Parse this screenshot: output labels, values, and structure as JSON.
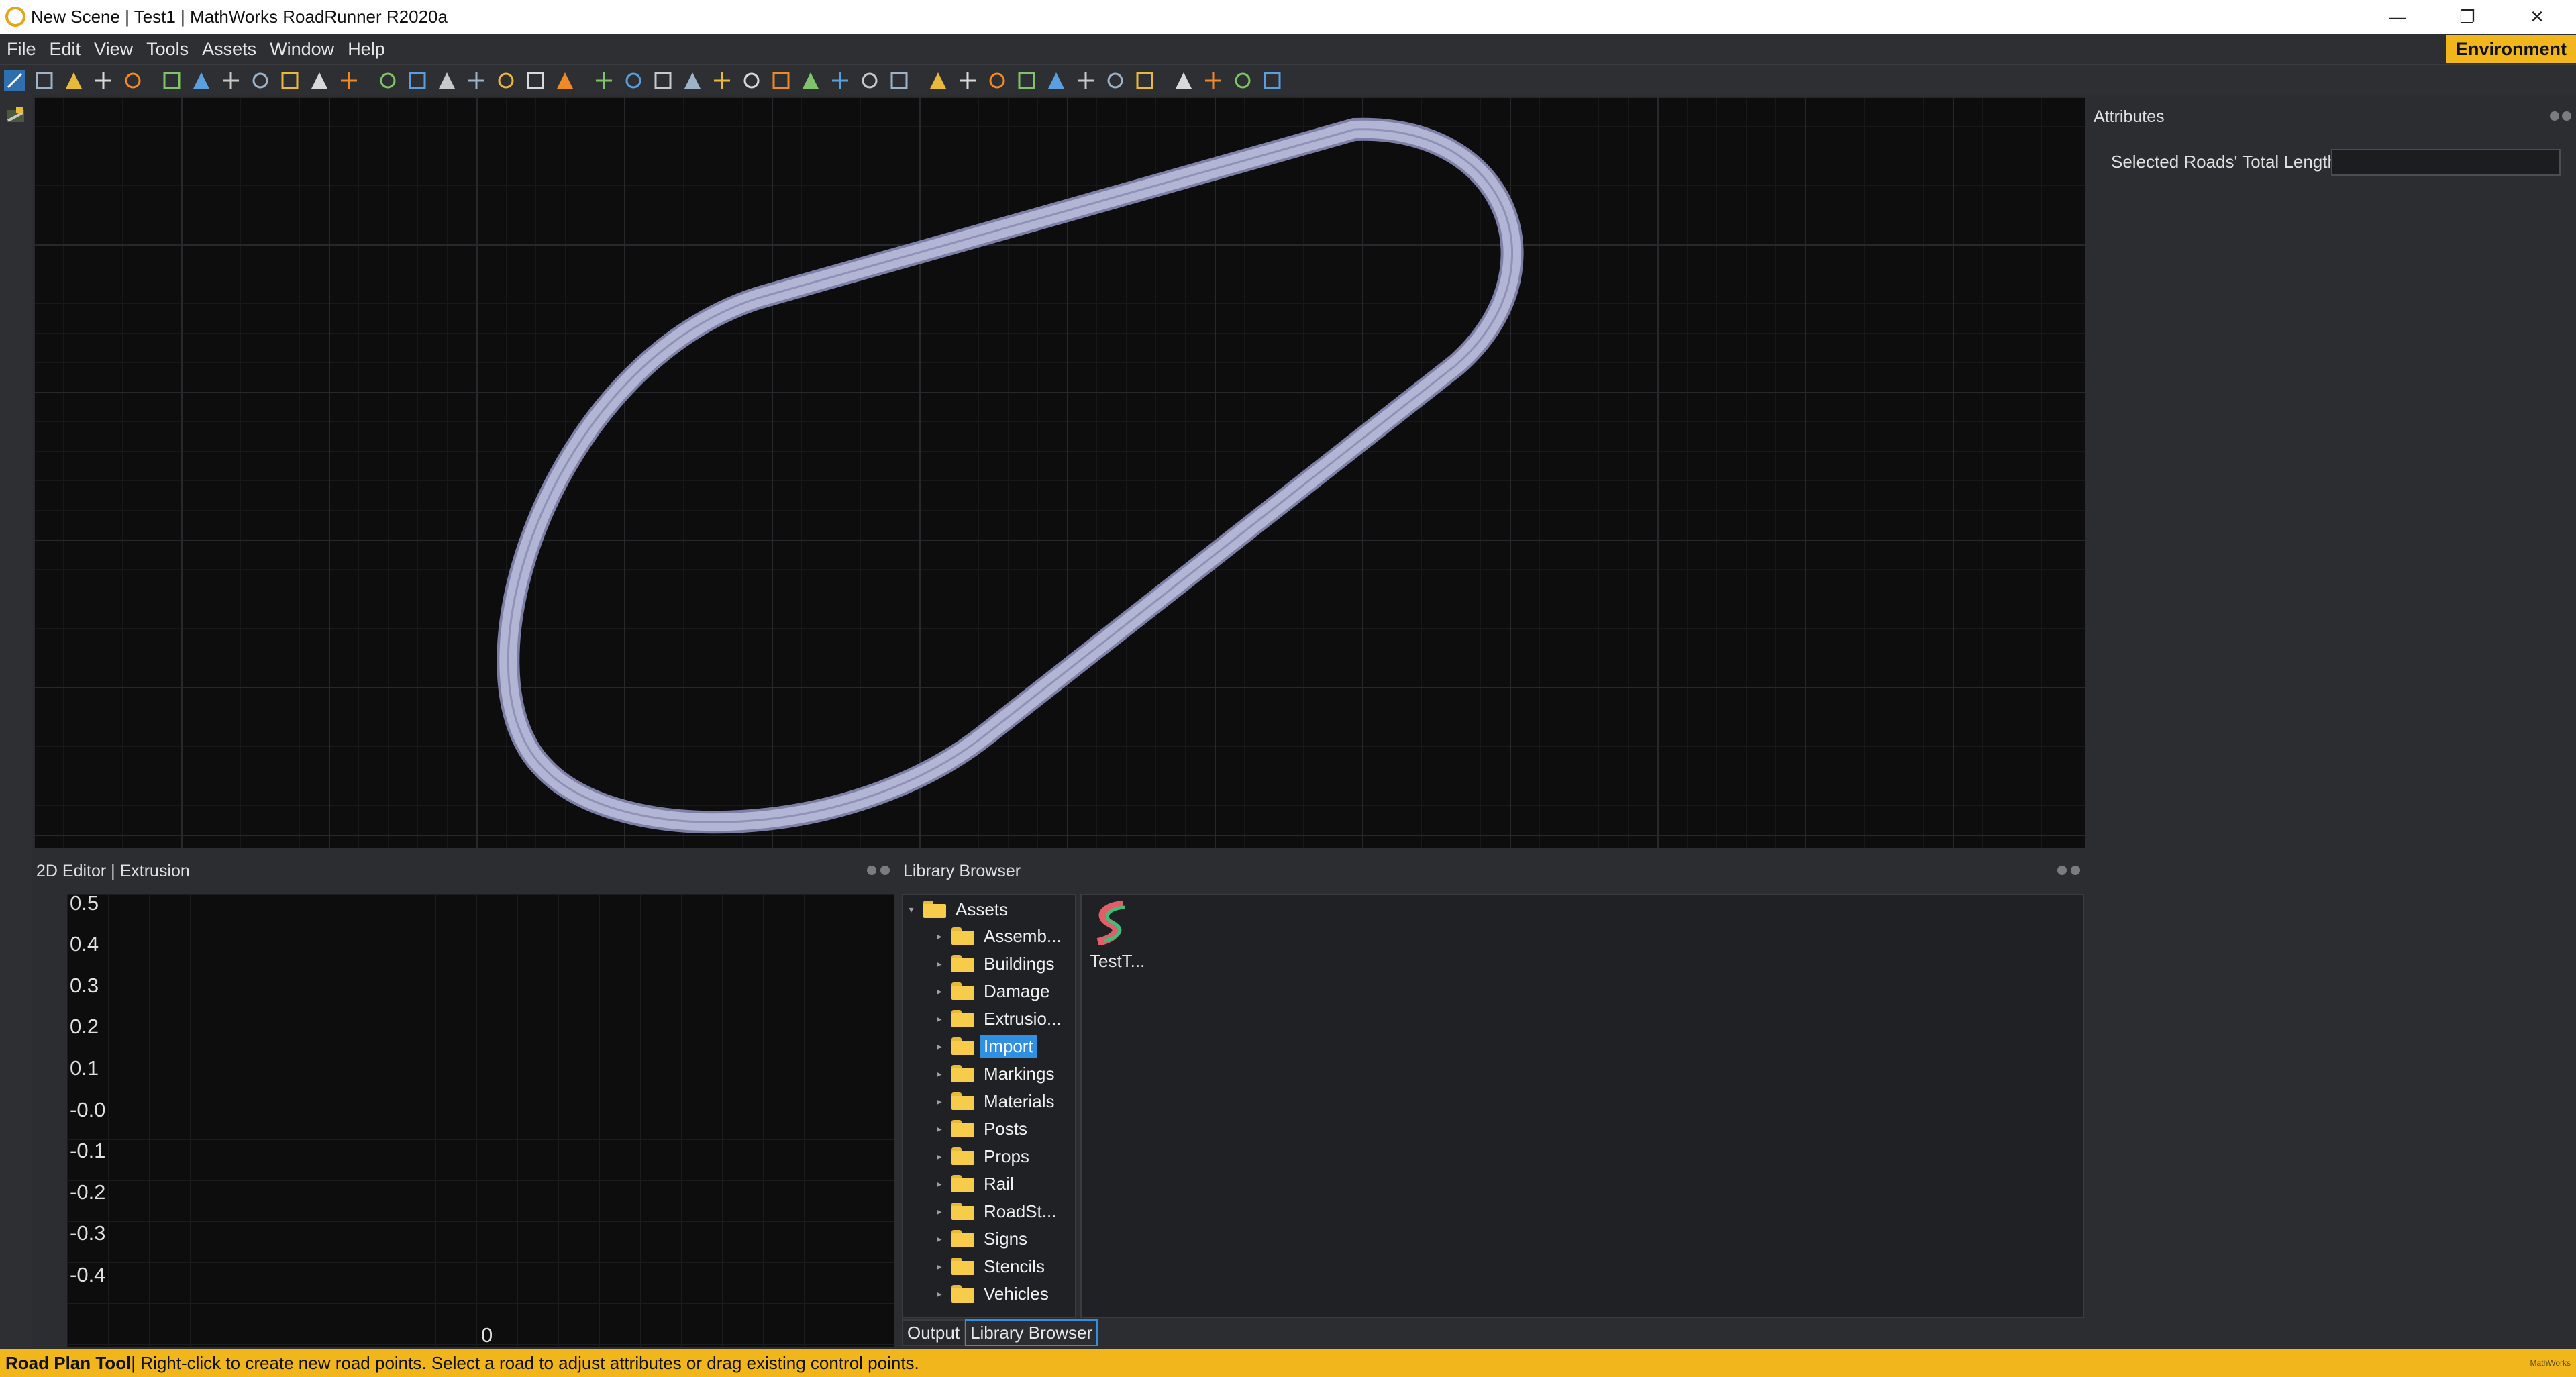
{
  "window": {
    "title": "New Scene | Test1 | MathWorks RoadRunner R2020a",
    "controls": [
      "minimize",
      "restore",
      "close"
    ]
  },
  "menu": {
    "items": [
      "File",
      "Edit",
      "View",
      "Tools",
      "Assets",
      "Window",
      "Help"
    ],
    "environment_label": "Environment"
  },
  "toolbar": {
    "tools": [
      "road-plan-tool-icon",
      "circle-tool-icon",
      "lane-tool-icon",
      "lane-width-tool-icon",
      "lane-form-tool-icon",
      "lane-carve-tool-icon",
      "crosswalk-tool-icon",
      "junction-tool-icon",
      "corner-tool-icon",
      "surface-tool-icon",
      "elevation-tool-icon",
      "stop-sign-tool-icon",
      "signal-tool-icon",
      "road-split-tool-icon",
      "maneuver-tool-icon",
      "marking-point-tool-icon",
      "marking-curve-tool-icon",
      "lane-marking-tool-icon",
      "marking-span-tool-icon",
      "marking-edge-tool-icon",
      "stencil-tool-icon",
      "speed-sign-tool-icon",
      "curve-road-tool-icon",
      "bridge-tool-icon",
      "sign-tool-icon",
      "marker-tool-icon",
      "prop-point-tool-icon",
      "prop-curve-tool-icon",
      "prop-polygon-tool-icon",
      "prop-span-tool-icon",
      "prop-set-tool-icon",
      "warning-sign-tool-icon",
      "terrain-tool-icon",
      "grid-tool-icon",
      "aerial-tool-icon",
      "elevation-map-tool-icon",
      "point-cloud-tool-icon",
      "layers-tool-icon",
      "scenario-tool-icon",
      "camera-tool-icon",
      "vehicle-tool-icon",
      "export-tool-icon"
    ]
  },
  "viewport": {
    "name": "Scene Editor",
    "road_color": "#a9abcc",
    "road_edge_color": "#7d7fa6"
  },
  "attributes": {
    "title": "Attributes",
    "field_label": "Selected Roads' Total Length",
    "field_value": ""
  },
  "editor2d": {
    "title": "2D Editor | Extrusion",
    "y_ticks": [
      "0.5",
      "0.4",
      "0.3",
      "0.2",
      "0.1",
      "-0.0",
      "-0.1",
      "-0.2",
      "-0.3",
      "-0.4"
    ],
    "x_ticks": [
      "0"
    ]
  },
  "library": {
    "title": "Library Browser",
    "root": "Assets",
    "folders": [
      "Assemb...",
      "Buildings",
      "Damage",
      "Extrusio...",
      "Import",
      "Markings",
      "Materials",
      "Posts",
      "Props",
      "Rail",
      "RoadSt...",
      "Signs",
      "Stencils",
      "Vehicles"
    ],
    "selected_folder": "Import",
    "asset_label": "TestT...",
    "tabs": [
      "Output",
      "Library Browser"
    ],
    "active_tab": "Library Browser"
  },
  "status": {
    "tool_name": "Road Plan Tool",
    "message": " | Right-click to create new road points. Select a road to adjust attributes or drag existing control points.",
    "brand": "MathWorks"
  }
}
